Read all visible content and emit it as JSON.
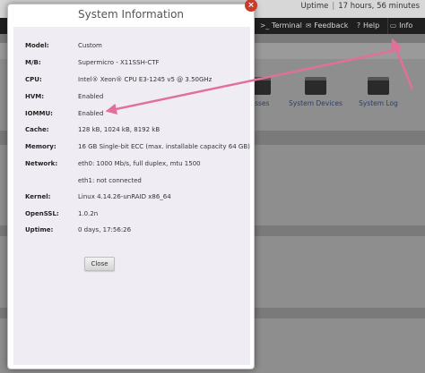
{
  "header": {
    "uptime_label": "Uptime",
    "uptime_value": "17 hours, 56 minutes"
  },
  "nav": {
    "terminal": "Terminal",
    "feedback": "Feedback",
    "help": "Help",
    "info": "Info"
  },
  "tools": [
    {
      "label": "esses",
      "icon": "window-icon"
    },
    {
      "label": "System Devices",
      "icon": "window-icon"
    },
    {
      "label": "System Log",
      "icon": "window-icon"
    }
  ],
  "dialog": {
    "title": "System Information",
    "close_glyph": "×",
    "rows": [
      {
        "label": "Model:",
        "value": "Custom"
      },
      {
        "label": "M/B:",
        "value": "Supermicro - X11SSH-CTF"
      },
      {
        "label": "CPU:",
        "value": "Intel® Xeon® CPU E3-1245 v5 @ 3.50GHz"
      },
      {
        "label": "HVM:",
        "value": "Enabled"
      },
      {
        "label": "IOMMU:",
        "value": "Enabled"
      },
      {
        "label": "Cache:",
        "value": "128 kB, 1024 kB, 8192 kB"
      },
      {
        "label": "Memory:",
        "value": "16 GB Single-bit ECC (max. installable capacity 64 GB)"
      },
      {
        "label": "Network:",
        "value": "eth0: 1000 Mb/s, full duplex, mtu 1500"
      },
      {
        "label": "",
        "value": "eth1: not connected"
      },
      {
        "label": "Kernel:",
        "value": "Linux 4.14.26-unRAID x86_64"
      },
      {
        "label": "OpenSSL:",
        "value": "1.0.2n"
      },
      {
        "label": "Uptime:",
        "value": "0 days, 17:56:26"
      }
    ],
    "close_button": "Close"
  },
  "colors": {
    "annotation_arrow": "#e0709a",
    "close_x": "#c83c2c",
    "navbar": "#1f1f1f"
  }
}
